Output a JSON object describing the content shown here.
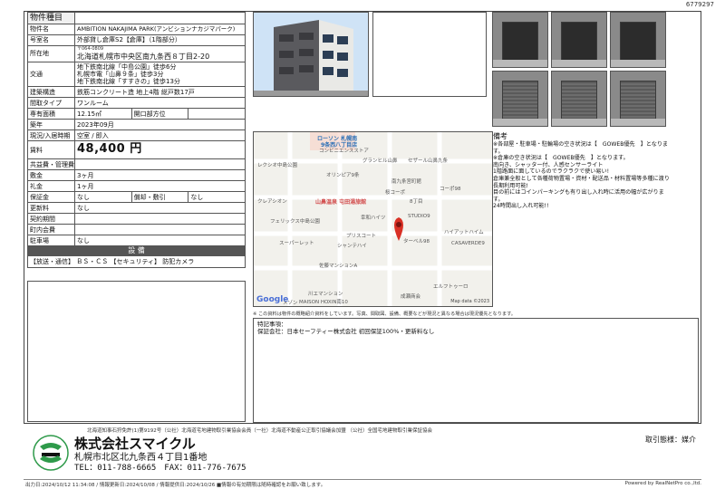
{
  "page_id": "6779297",
  "spec": {
    "header_label": "物件種目",
    "rows": {
      "name": {
        "label": "物件名",
        "value": "AMBITION NAKAJIMA PARK(アンビションナカジマパーク)"
      },
      "room": {
        "label": "号室名",
        "value": "外部貸し倉庫S2【倉庫】（1階部分）"
      },
      "location": {
        "label": "所在地",
        "zip": "〒064-0809",
        "value": "北海道札幌市中央区南九条西８丁目2-20"
      },
      "transport": {
        "label": "交通",
        "lines": [
          "地下鉄南北線「中島公園」徒歩6分",
          "札幌市電「山鼻９条」徒歩3分",
          "地下鉄南北線「すすきの」徒歩13分"
        ]
      },
      "structure": {
        "label": "建築構造",
        "value": "鉄筋コンクリート造 地上4階 総戸数17戸"
      },
      "layout": {
        "label": "間取タイプ",
        "value": "ワンルーム"
      },
      "area": {
        "label": "専有面積",
        "value": "12.15㎡",
        "sub_label": "開口部方位",
        "sub_value": ""
      },
      "built": {
        "label": "築年",
        "value": "2023年09月"
      },
      "status": {
        "label": "現況/入居時期",
        "value": "空室 / 即入"
      },
      "rent": {
        "label": "賃料",
        "value": "48,400 円"
      },
      "common": {
        "label": "共益費・管理費",
        "value": ""
      },
      "deposit": {
        "label": "敷金",
        "value": "3ヶ月"
      },
      "key_money": {
        "label": "礼金",
        "value": "1ヶ月"
      },
      "guarantee": {
        "label": "保証金",
        "value": "なし",
        "sub_label": "償却・敷引",
        "sub_value": "なし"
      },
      "renewal": {
        "label": "更新料",
        "value": "なし"
      },
      "contract": {
        "label": "契約期間",
        "value": ""
      },
      "community": {
        "label": "町内会費",
        "value": ""
      },
      "parking": {
        "label": "駐車場",
        "value": "なし"
      }
    },
    "equipment_header": "設 備",
    "equipment": "【放送・通信】 ＢＳ・ＣＳ 【セキュリティ】 防犯カメラ"
  },
  "map": {
    "labels": [
      "ローソン 札幌南",
      "9条西八丁目店",
      "コンビニエンスストア",
      "レクシオ中島公園",
      "グランヒル山鼻",
      "セザール山鼻九条",
      "オリンピア9条",
      "南九条宮町館",
      "桜コーポ",
      "コーポ98",
      "クレアシオン",
      "8丁目",
      "山鼻温泉 屯田湯旅館",
      "フェリックス中島公園",
      "幸和ハイツ",
      "STUDIO9",
      "ハイアットハイム",
      "スーパーレット",
      "プリスコート",
      "ターベル98",
      "シャンテハイ",
      "CASAVERDE9",
      "佐藤マンションA",
      "エルフトゥーロ",
      "川エマンション",
      "MAISON HOXIN南10",
      "成瀬商会",
      "メゾン"
    ],
    "brand": "Google",
    "credit": "Map data ©2023"
  },
  "disclaimer": "※ この資料は物件の概略紹介資料をしています。写真、間取図、設備、概要などが現況と異なる場合は現況優先となります。",
  "remarks": {
    "title": "備考",
    "lines": [
      "※各部屋・駐車場・駐輪場の空き状況は【　GOWEB優先　】となりま",
      "す。",
      "※倉庫の空き状況は【　GOWEB優先　】となります。",
      "南向き、シャッター付、人感センサーライト",
      "1階路面に面しているのでラクラクで使い易い!",
      "倉庫兼全般として各種荷物置場・資材・配送品・材料置場等多種に渡り",
      "長期利用可能!",
      "目の前にはコインパーキングも有り出し入れ時に活用の幅が広がりま",
      "す。",
      "24時間出し入れ可能!!"
    ]
  },
  "notes": {
    "label": "特記事項：",
    "guarantor": "保証会社：日本セーフティー株式会社 初回保証100%・更新料なし"
  },
  "footer": {
    "license": "北海道知事石狩免許(1)第9192号（公社）北海道宅地建物取引業協会会員（一社）北海道不動産公正取引協議会加盟 （公社）全国宅地建物取引業保証協会",
    "company": "株式会社スマイクル",
    "address": "札幌市北区北九条西４丁目1番地",
    "tel": "TEL：011-788-6665　FAX：011-776-7675",
    "deal_type": "取引態様：媒介",
    "printed": "出力日:2024/10/12 11:34:08 / 情報更新日:2024/10/08 / 情報提供日:2024/10/26 ■情報の有効期限は随時確認をお願い致します。",
    "powered": "Powered by RealNetPro co.,ltd."
  }
}
